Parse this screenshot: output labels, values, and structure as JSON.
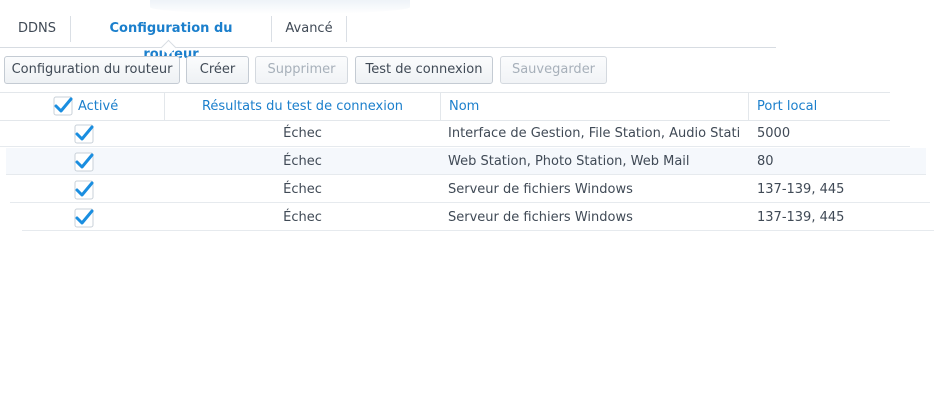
{
  "tabs": [
    {
      "label": "DDNS",
      "active": false
    },
    {
      "label": "Configuration du routeur",
      "active": true
    },
    {
      "label": "Avancé",
      "active": false
    }
  ],
  "toolbar": {
    "router_config_label": "Configuration du routeur",
    "create_label": "Créer",
    "delete_label": "Supprimer",
    "test_label": "Test de connexion",
    "save_label": "Sauvegarder"
  },
  "table": {
    "headers": {
      "enabled": "Activé",
      "result": "Résultats du test de connexion",
      "name": "Nom",
      "local_port": "Port local"
    },
    "header_checked": true,
    "rows": [
      {
        "checked": true,
        "result": "Échec",
        "name": "Interface de Gestion, File Station, Audio Stati...",
        "local_port": "5000"
      },
      {
        "checked": true,
        "result": "Échec",
        "name": "Web Station, Photo Station, Web Mail",
        "local_port": "80"
      },
      {
        "checked": true,
        "result": "Échec",
        "name": "Serveur de fichiers Windows",
        "local_port": "137-139, 445"
      },
      {
        "checked": true,
        "result": "Échec",
        "name": "Serveur de fichiers Windows",
        "local_port": "137-139, 445"
      }
    ]
  },
  "colors": {
    "accent": "#1b7fcc",
    "check": "#1a8ee0",
    "row_alt": "#f5f8fc"
  }
}
